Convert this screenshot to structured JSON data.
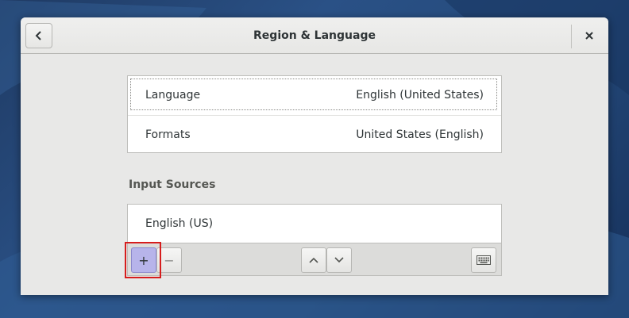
{
  "window": {
    "title": "Region & Language"
  },
  "icons": {
    "back": "go-previous-icon",
    "close": "window-close-icon",
    "add": "list-add-icon",
    "remove": "list-remove-icon",
    "up": "go-up-icon",
    "down": "go-down-icon",
    "keyboard": "input-keyboard-icon"
  },
  "settings": {
    "language_label": "Language",
    "language_value": "English (United States)",
    "formats_label": "Formats",
    "formats_value": "United States (English)"
  },
  "input_sources": {
    "heading": "Input Sources",
    "items": [
      {
        "label": "English (US)"
      }
    ],
    "add_label": "+",
    "remove_label": "−"
  },
  "colors": {
    "add_button_highlight": "#b7b4ea",
    "annotation_box": "#d61d1d"
  }
}
